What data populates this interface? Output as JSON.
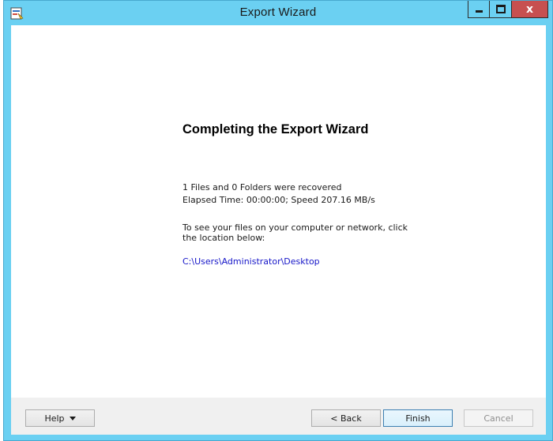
{
  "window": {
    "title": "Export Wizard",
    "close_glyph": "x",
    "icon": "wizard-app-icon"
  },
  "content": {
    "heading": "Completing the Export Wizard",
    "recovered_text": "1 Files and 0 Folders were recovered",
    "elapsed_text": "Elapsed Time: 00:00:00; Speed 207.16 MB/s",
    "instruction_line1": "To see your files on your computer or network, click",
    "instruction_line2": "the location below:",
    "location_link": "C:\\Users\\Administrator\\Desktop"
  },
  "buttons": {
    "help": "Help",
    "back": "< Back",
    "finish": "Finish",
    "cancel": "Cancel"
  },
  "colors": {
    "titlebar": "#6bd0f2",
    "close_button": "#c75050",
    "link": "#1515c8"
  }
}
